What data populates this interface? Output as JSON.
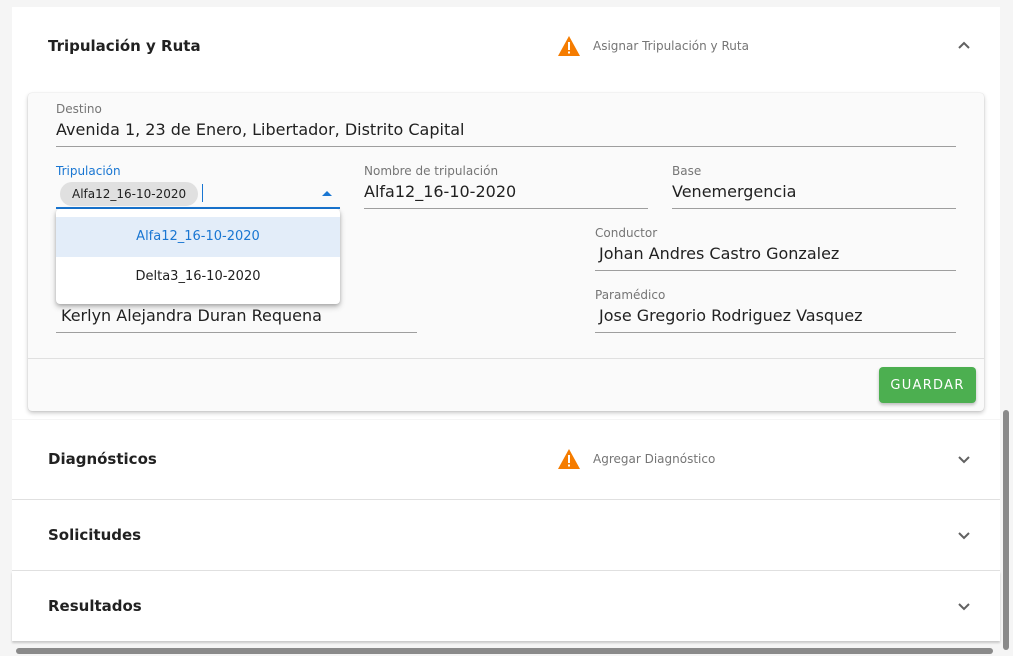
{
  "sections": {
    "tripulacion": {
      "title": "Tripulación y Ruta",
      "hint": "Asignar Tripulación y Ruta",
      "expanded": true
    },
    "diagnosticos": {
      "title": "Diagnósticos",
      "hint": "Agregar Diagnóstico"
    },
    "solicitudes": {
      "title": "Solicitudes"
    },
    "resultados": {
      "title": "Resultados"
    }
  },
  "form": {
    "destino": {
      "label": "Destino",
      "value": "Avenida 1, 23 de Enero, Libertador, Distrito Capital"
    },
    "tripulacion": {
      "label": "Tripulación",
      "chip": "Alfa12_16-10-2020"
    },
    "nombre_tripulacion": {
      "label": "Nombre de tripulación",
      "value": "Alfa12_16-10-2020"
    },
    "base": {
      "label": "Base",
      "value": "Venemergencia"
    },
    "conductor": {
      "label": "Conductor",
      "value": "Johan Andres Castro Gonzalez"
    },
    "tercer_miembro": {
      "value": "Kerlyn Alejandra Duran Requena"
    },
    "paramedico": {
      "label": "Paramédico",
      "value": "Jose Gregorio Rodriguez Vasquez"
    },
    "save_label": "GUARDAR"
  },
  "dropdown": {
    "options": [
      "Alfa12_16-10-2020",
      "Delta3_16-10-2020"
    ],
    "selected_index": 0
  },
  "colors": {
    "accent": "#1976d2",
    "warning": "#f57c00",
    "save": "#4caf50"
  },
  "icons": {
    "warning": "warning-triangle-icon",
    "collapse": "chevron-up-icon",
    "expand": "chevron-down-icon"
  }
}
